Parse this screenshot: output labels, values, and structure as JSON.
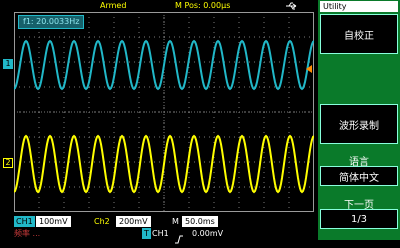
{
  "header": {
    "trigger_status": "Armed",
    "m_pos_label": "M Pos: 0.00µs",
    "usb_icon": "usb-icon"
  },
  "screen": {
    "freq_label": "f1: 20.0033Hz",
    "ch1_marker": "1",
    "ch2_marker": "2",
    "trigger_marker": "T",
    "colors": {
      "ch1": "#21b8c8",
      "ch2": "#ffff00",
      "grid": "#7a7a7a",
      "menu_bg": "#0a7a2a"
    }
  },
  "status": {
    "ch1_label": "CH1",
    "ch1_scale": "100mV",
    "ch2_label": "Ch2",
    "ch2_scale": "200mV",
    "m_label": "M",
    "timebase": "50.0ms",
    "trig_label": "T",
    "trig_source": "CH1",
    "trig_level": "0.00mV",
    "freq_partial": "频率 ..."
  },
  "menu": {
    "title": "Utility",
    "self_cal": "自校正",
    "waveform_record": "波形录制",
    "language_label": "语言",
    "language_value": "简体中文",
    "next_page_label": "下一页",
    "page_indicator": "1/3"
  }
}
